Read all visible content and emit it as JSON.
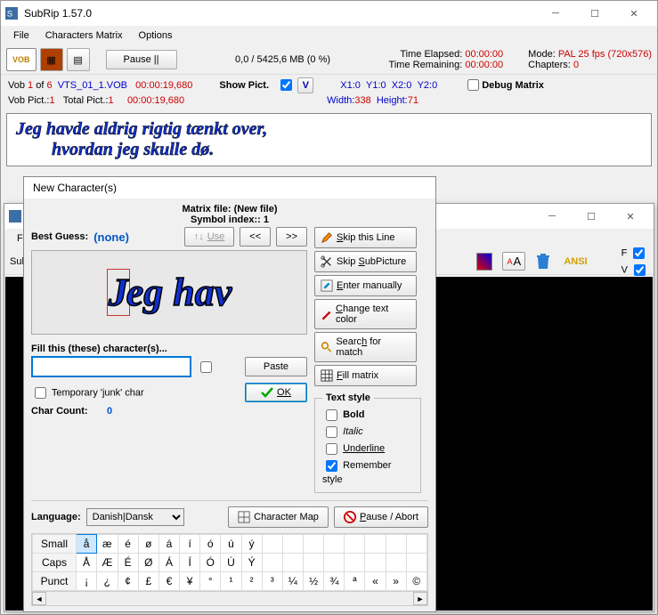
{
  "mainWindow": {
    "title": "SubRip 1.57.0",
    "menu": {
      "file": "File",
      "chars": "Characters Matrix",
      "options": "Options"
    },
    "pauseBtn": "Pause  ||",
    "progress": "0,0 / 5425,6 MB (0 %)",
    "timeElapsedLabel": "Time Elapsed:",
    "timeElapsedValue": "00:00:00",
    "timeRemainingLabel": "Time Remaining:",
    "timeRemainingValue": "00:00:00",
    "modeLabel": "Mode:",
    "modeValue": "PAL 25 fps (720x576)",
    "chaptersLabel": "Chapters:",
    "chaptersValue": "0",
    "vob": {
      "label": "Vob",
      "cur": "1",
      "of": "of",
      "total": "6",
      "file": "VTS_01_1.VOB",
      "t1": "00:00:19,680"
    },
    "vobPict": {
      "label": "Vob Pict.:",
      "val": "1",
      "totalLabel": "Total Pict.:",
      "totalVal": "1",
      "t2": "00:00:19,680"
    },
    "showPict": "Show Pict.",
    "coords": {
      "x1": "X1:0",
      "y1": "Y1:0",
      "x2": "X2:0",
      "y2": "Y2:0",
      "w": "Width:",
      "wVal": "338",
      "h": "Height:",
      "hVal": "71"
    },
    "debugMatrix": "Debug Matrix",
    "subtitleLine1": "Jeg havde aldrig rigtig tænkt over,",
    "subtitleLine2": "hvordan jeg skulle dø."
  },
  "secondWindow": {
    "menu": {
      "file": "File"
    },
    "sub": "Sub",
    "ansi": "ANSI",
    "F": "F",
    "V": "V"
  },
  "charDialog": {
    "title": "New Character(s)",
    "matrixFile": "Matrix file: (New file)",
    "symbolIndex": "Symbol index:: 1",
    "bestGuessLabel": "Best Guess:",
    "bestGuessValue": "(none)",
    "useBtn": "Use",
    "prevBtn": "<<",
    "nextBtn": ">>",
    "previewText": "Jeg hav",
    "fillLabel": "Fill this (these) character(s)...",
    "tempJunk": "Temporary 'junk' char",
    "charCountLabel": "Char Count:",
    "charCountValue": "0",
    "pasteBtn": "Paste",
    "okBtn": "OK",
    "languageLabel": "Language:",
    "languageValue": "Danish|Dansk",
    "charMapBtn": "Character Map",
    "pauseAbortBtn": "Pause / Abort",
    "actions": {
      "skipLine": "Skip this Line",
      "skipSub": "Skip SubPicture",
      "enterMan": "Enter manually",
      "changeColor": "Change text color",
      "searchMatch": "Search for match",
      "fillMatrix": "Fill matrix"
    },
    "textStyle": {
      "legend": "Text style",
      "bold": "Bold",
      "italic": "Italic",
      "underline": "Underline",
      "remember": "Remember style"
    },
    "grid": {
      "rowLabels": {
        "small": "Small",
        "caps": "Caps",
        "punct": "Punct"
      },
      "small": [
        "å",
        "æ",
        "é",
        "ø",
        "á",
        "í",
        "ó",
        "ú",
        "ý"
      ],
      "caps": [
        "Å",
        "Æ",
        "É",
        "Ø",
        "Á",
        "Í",
        "Ó",
        "Ú",
        "Ý"
      ],
      "punct": [
        "¡",
        "¿",
        "¢",
        "£",
        "€",
        "¥",
        "°",
        "¹",
        "²",
        "³",
        "¼",
        "½",
        "¾",
        "ª",
        "«",
        "»",
        "©"
      ]
    }
  }
}
